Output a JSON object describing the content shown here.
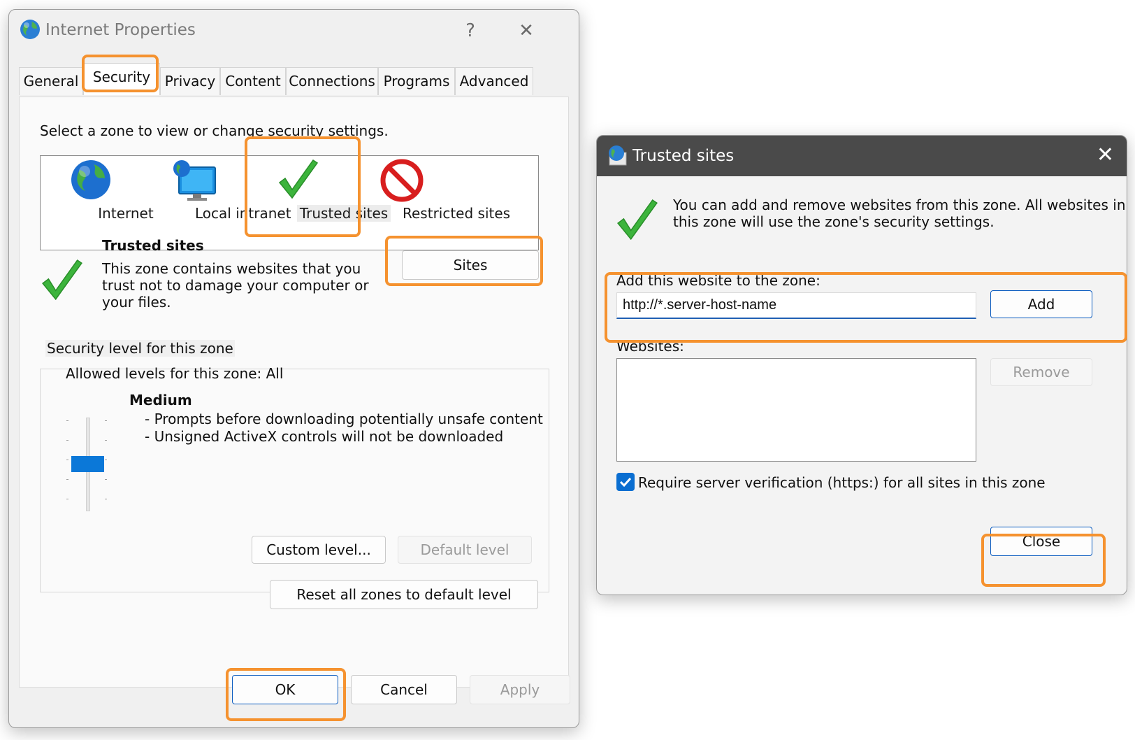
{
  "internet_properties": {
    "title": "Internet Properties",
    "help_glyph": "?",
    "close_glyph": "✕",
    "tabs": [
      "General",
      "Security",
      "Privacy",
      "Content",
      "Connections",
      "Programs",
      "Advanced"
    ],
    "active_tab": "Security",
    "zone_prompt": "Select a zone to view or change security settings.",
    "zones": [
      "Internet",
      "Local intranet",
      "Trusted sites",
      "Restricted sites"
    ],
    "selected_zone": "Trusted sites",
    "zone_heading": "Trusted sites",
    "zone_description_lines": [
      "This zone contains websites that you",
      "trust not to damage your computer or",
      "your files."
    ],
    "sites_button": "Sites",
    "security_group_label": "Security level for this zone",
    "allowed_levels": "Allowed levels for this zone: All",
    "level_name": "Medium",
    "level_details": [
      "- Prompts before downloading potentially unsafe content",
      "- Unsigned ActiveX controls will not be downloaded"
    ],
    "custom_level_button": "Custom level...",
    "default_level_button": "Default level",
    "reset_button": "Reset all zones to default level",
    "ok_button": "OK",
    "cancel_button": "Cancel",
    "apply_button": "Apply"
  },
  "trusted_sites": {
    "title": "Trusted sites",
    "close_glyph": "✕",
    "intro_lines": [
      "You can add and remove websites from this zone. All websites in",
      "this zone will use the zone's security settings."
    ],
    "add_label": "Add this website to the zone:",
    "add_input_value": "http://*.server-host-name",
    "add_button": "Add",
    "websites_label": "Websites:",
    "websites": [],
    "remove_button": "Remove",
    "require_https_label": "Require server verification (https:) for all sites in this zone",
    "require_https_checked": true,
    "close_button": "Close"
  },
  "colors": {
    "highlight": "#f5922f",
    "accent": "#0a6ed1",
    "check_green": "#3cb43c",
    "restricted_red": "#d81e1e"
  },
  "icons": [
    "globe-icon",
    "monitor-globe-icon",
    "checkmark-icon",
    "no-entry-icon",
    "close-icon",
    "help-icon"
  ]
}
